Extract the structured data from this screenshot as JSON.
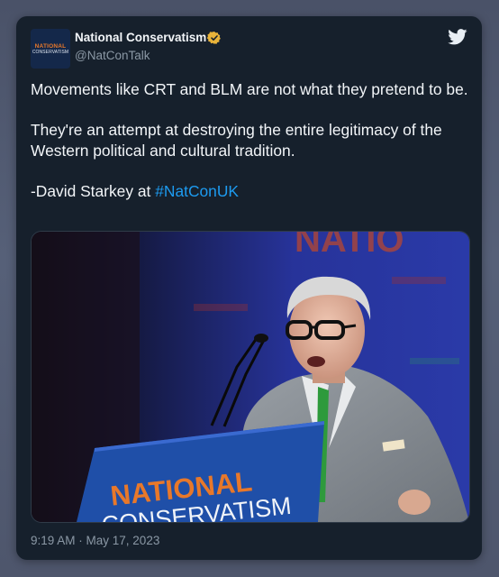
{
  "tweet": {
    "author": {
      "display_name": "National Conservatism",
      "handle": "@NatConTalk",
      "avatar_line1": "NATIONAL",
      "avatar_line2": "CONSERVATISM",
      "verified_color": "#e8b33a"
    },
    "text": {
      "para1": "Movements like CRT and BLM are not what they pretend to be.",
      "para2": "They're an attempt at destroying the entire legitimacy of the Western political and cultural tradition.",
      "para3_prefix": "-David Starkey at ",
      "hashtag": "#NatConUK"
    },
    "media": {
      "backdrop_text": "NATIO",
      "podium_line1": "NATIONAL",
      "podium_line2": "CONSERVATISM",
      "podium_color": "#1f4fa8",
      "accent_color": "#e8782a"
    },
    "timestamp": "9:19 AM · May 17, 2023"
  },
  "icons": {
    "brand": "twitter-bird-icon",
    "verified": "verified-badge-icon"
  },
  "colors": {
    "card_bg": "#16202c",
    "link": "#1d9bf0",
    "twitter_bird": "#e8eef4"
  }
}
